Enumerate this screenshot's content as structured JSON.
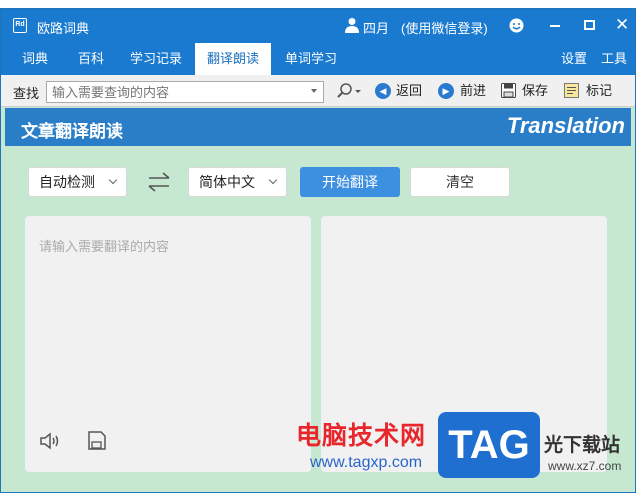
{
  "window": {
    "title": "欧路词典",
    "user": "四月",
    "login": "(使用微信登录)",
    "controls": {
      "close": "✕"
    }
  },
  "menu": {
    "tabs": [
      {
        "label": "词典"
      },
      {
        "label": "百科"
      },
      {
        "label": "学习记录"
      },
      {
        "label": "翻译朗读"
      },
      {
        "label": "单词学习"
      }
    ],
    "active_tab": "翻译朗读",
    "settings": "设置",
    "tools": "工具"
  },
  "toolbar": {
    "lookup_label": "查找",
    "search_placeholder": "输入需要查询的内容",
    "back": "返回",
    "forward": "前进",
    "save": "保存",
    "mark": "标记"
  },
  "translate": {
    "title": "文章翻译朗读",
    "brand": "Translation",
    "source_lang": "自动检测",
    "target_lang": "简体中文",
    "start_button": "开始翻译",
    "clear_button": "清空",
    "input_placeholder": "请输入需要翻译的内容"
  },
  "watermark": {
    "cn_text": "电脑技术网",
    "url": "www.tagxp.com",
    "tag": "TAG",
    "site_name": "光下载站",
    "site_url": "www.xz7.com"
  },
  "colors": {
    "titlebar": "#1a7ad0",
    "header": "#2a7ec8",
    "background": "#c6e8d0",
    "primary_button": "#3d8fe0"
  }
}
